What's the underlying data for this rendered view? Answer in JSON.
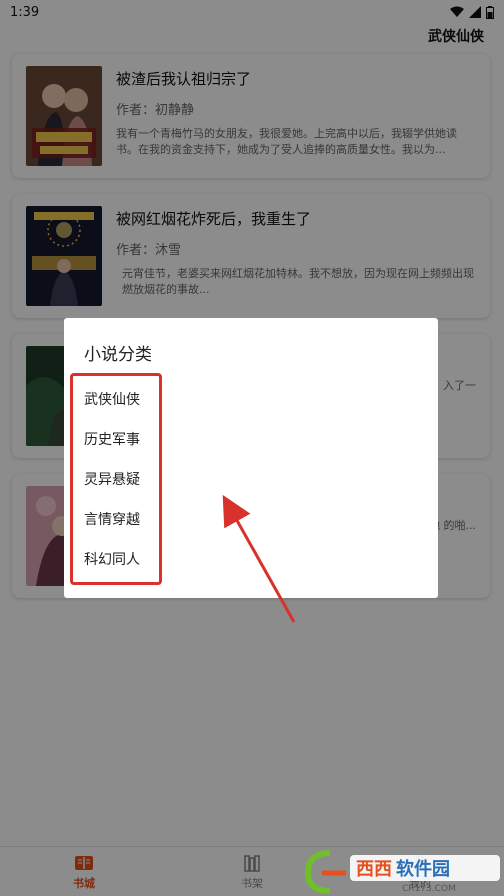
{
  "status_bar": {
    "time": "1:39"
  },
  "header": {
    "current_category": "武侠仙侠"
  },
  "books": [
    {
      "title": "被渣后我认祖归宗了",
      "author": "作者：初静静",
      "description": "我有一个青梅竹马的女朋友，我很爱她。上完高中以后，我辍学供她读书。在我的资金支持下，她成为了受人追捧的高质量女性。我以为..."
    },
    {
      "title": "被网红烟花炸死后，我重生了",
      "author": "作者：沐雪",
      "description": "元宵佳节，老婆买来网红烟花加特林。我不想放，因为现在网上频频出现燃放烟花的事故..."
    },
    {
      "title": "",
      "author": "",
      "description": "入了一"
    },
    {
      "title": "",
      "author": "",
      "description": "着他 的啪..."
    }
  ],
  "dialog": {
    "title": "小说分类",
    "categories": [
      "武侠仙侠",
      "历史军事",
      "灵异悬疑",
      "言情穿越",
      "科幻同人"
    ]
  },
  "nav": {
    "items": [
      {
        "label": "书城"
      },
      {
        "label": "书架"
      },
      {
        "label": "我的"
      }
    ]
  },
  "watermark": {
    "brand": "西西软件园",
    "url": "CR173.COM"
  },
  "colors": {
    "accent": "#e5501e",
    "highlight": "#d9312b"
  }
}
